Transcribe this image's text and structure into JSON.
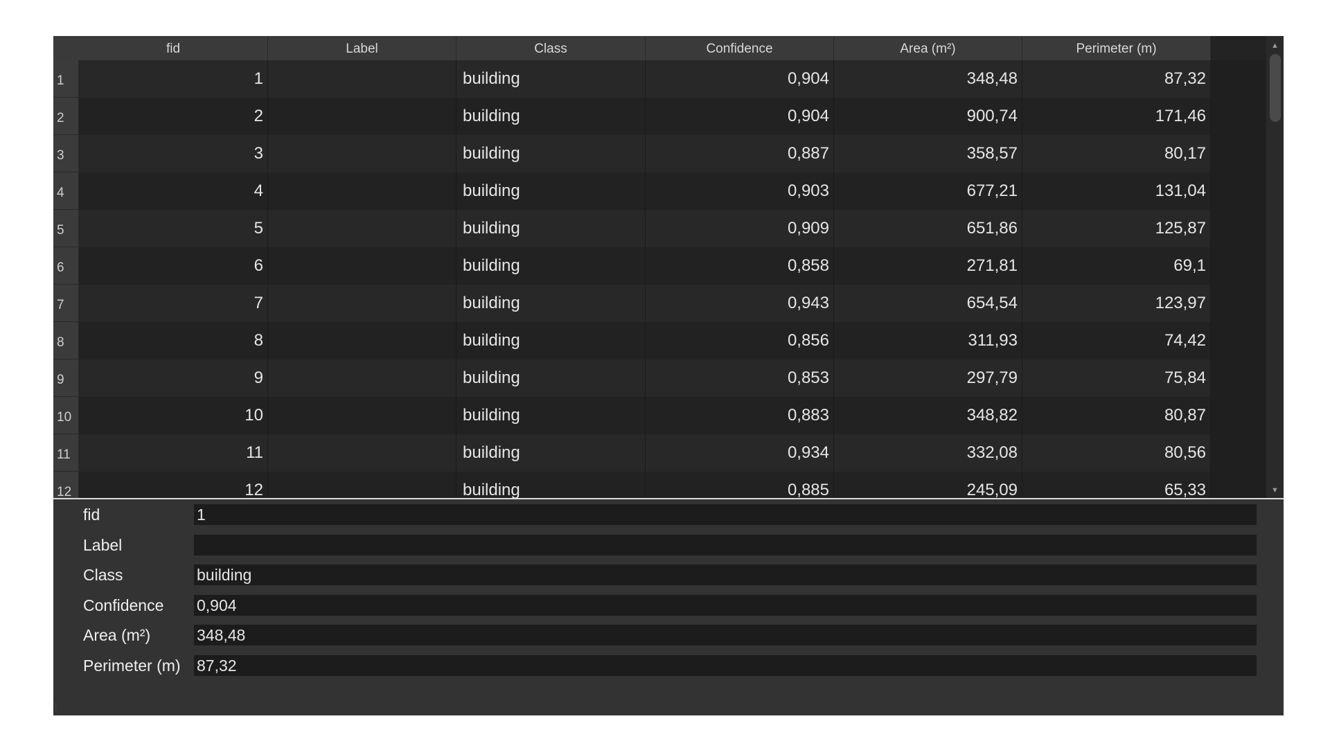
{
  "columns": [
    "fid",
    "Label",
    "Class",
    "Confidence",
    "Area (m²)",
    "Perimeter (m)"
  ],
  "rows": [
    {
      "n": "1",
      "fid": "1",
      "label": "",
      "cls": "building",
      "conf": "0,904",
      "area": "348,48",
      "perim": "87,32"
    },
    {
      "n": "2",
      "fid": "2",
      "label": "",
      "cls": "building",
      "conf": "0,904",
      "area": "900,74",
      "perim": "171,46"
    },
    {
      "n": "3",
      "fid": "3",
      "label": "",
      "cls": "building",
      "conf": "0,887",
      "area": "358,57",
      "perim": "80,17"
    },
    {
      "n": "4",
      "fid": "4",
      "label": "",
      "cls": "building",
      "conf": "0,903",
      "area": "677,21",
      "perim": "131,04"
    },
    {
      "n": "5",
      "fid": "5",
      "label": "",
      "cls": "building",
      "conf": "0,909",
      "area": "651,86",
      "perim": "125,87"
    },
    {
      "n": "6",
      "fid": "6",
      "label": "",
      "cls": "building",
      "conf": "0,858",
      "area": "271,81",
      "perim": "69,1"
    },
    {
      "n": "7",
      "fid": "7",
      "label": "",
      "cls": "building",
      "conf": "0,943",
      "area": "654,54",
      "perim": "123,97"
    },
    {
      "n": "8",
      "fid": "8",
      "label": "",
      "cls": "building",
      "conf": "0,856",
      "area": "311,93",
      "perim": "74,42"
    },
    {
      "n": "9",
      "fid": "9",
      "label": "",
      "cls": "building",
      "conf": "0,853",
      "area": "297,79",
      "perim": "75,84"
    },
    {
      "n": "10",
      "fid": "10",
      "label": "",
      "cls": "building",
      "conf": "0,883",
      "area": "348,82",
      "perim": "80,87"
    },
    {
      "n": "11",
      "fid": "11",
      "label": "",
      "cls": "building",
      "conf": "0,934",
      "area": "332,08",
      "perim": "80,56"
    },
    {
      "n": "12",
      "fid": "12",
      "label": "",
      "cls": "building",
      "conf": "0,885",
      "area": "245,09",
      "perim": "65,33"
    }
  ],
  "form": {
    "fields": [
      {
        "label": "fid",
        "value": "1"
      },
      {
        "label": "Label",
        "value": ""
      },
      {
        "label": "Class",
        "value": "building"
      },
      {
        "label": "Confidence",
        "value": "0,904"
      },
      {
        "label": "Area (m²)",
        "value": "348,48"
      },
      {
        "label": "Perimeter (m)",
        "value": "87,32"
      }
    ]
  },
  "icons": {
    "scroll_up": "triangle-up",
    "scroll_down": "triangle-down"
  },
  "colors": {
    "background": "#333333",
    "table_bg": "#1f1f1f",
    "header_bg": "#3a3a3a",
    "text": "#e6e6e6"
  }
}
